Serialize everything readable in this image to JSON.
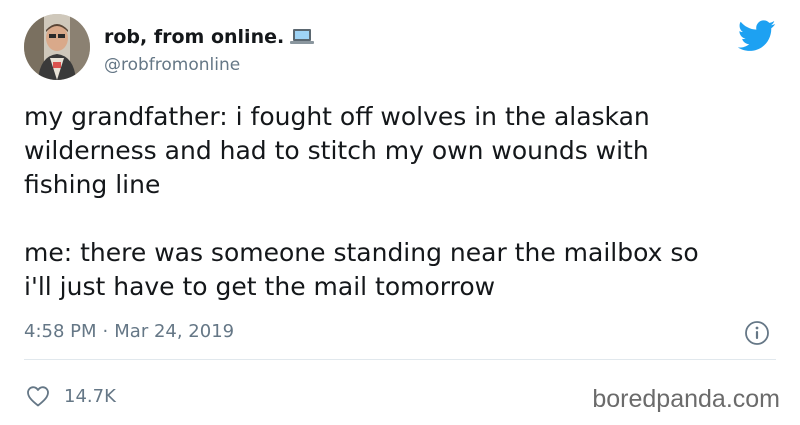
{
  "tweet": {
    "author": {
      "display_name": "rob, from online.",
      "handle": "@robfromonline",
      "avatar_icon": "avatar-photo",
      "name_emoji_icon": "laptop-icon"
    },
    "brand_icon": "twitter-bird-icon",
    "text_line1": "my grandfather: i fought off wolves in the alaskan\nwilderness and had to stitch my own wounds with\nfishing line",
    "text_line2": "me: there was someone standing near the mailbox so\ni'll just have to get the mail tomorrow",
    "time": "4:58 PM",
    "separator": "·",
    "date": "Mar 24, 2019",
    "info_icon": "info-icon",
    "likes": {
      "icon": "heart-icon",
      "count": "14.7K"
    }
  },
  "watermark": "boredpanda.com",
  "colors": {
    "twitter_blue": "#1da1f2",
    "text": "#14171a",
    "secondary_text": "#657786",
    "divider": "#e1e8ed"
  }
}
